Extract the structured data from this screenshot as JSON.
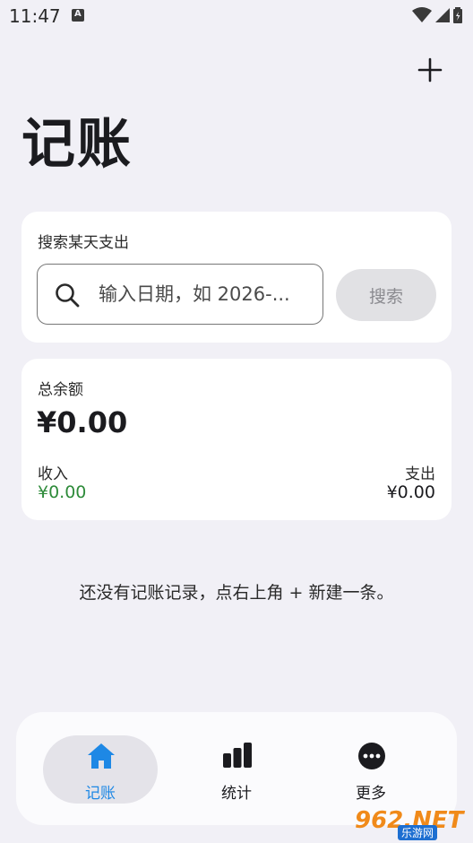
{
  "status": {
    "time": "11:47"
  },
  "header": {
    "title": "记账"
  },
  "search": {
    "label": "搜索某天支出",
    "placeholder": "输入日期，如 2026-...",
    "button_label": "搜索"
  },
  "balance": {
    "label": "总余额",
    "value": "¥0.00",
    "income_label": "收入",
    "income_value": "¥0.00",
    "expense_label": "支出",
    "expense_value": "¥0.00"
  },
  "empty_message": "还没有记账记录，点右上角 + 新建一条。",
  "nav": {
    "items": [
      {
        "label": "记账",
        "icon": "home-icon",
        "active": true
      },
      {
        "label": "统计",
        "icon": "bar-chart-icon",
        "active": false
      },
      {
        "label": "更多",
        "icon": "more-icon",
        "active": false
      }
    ]
  },
  "colors": {
    "accent": "#1e88e5",
    "income": "#2e8b3a",
    "background": "#f1f0f6"
  },
  "watermark": {
    "main": "962.NET",
    "sub": "乐游网"
  }
}
